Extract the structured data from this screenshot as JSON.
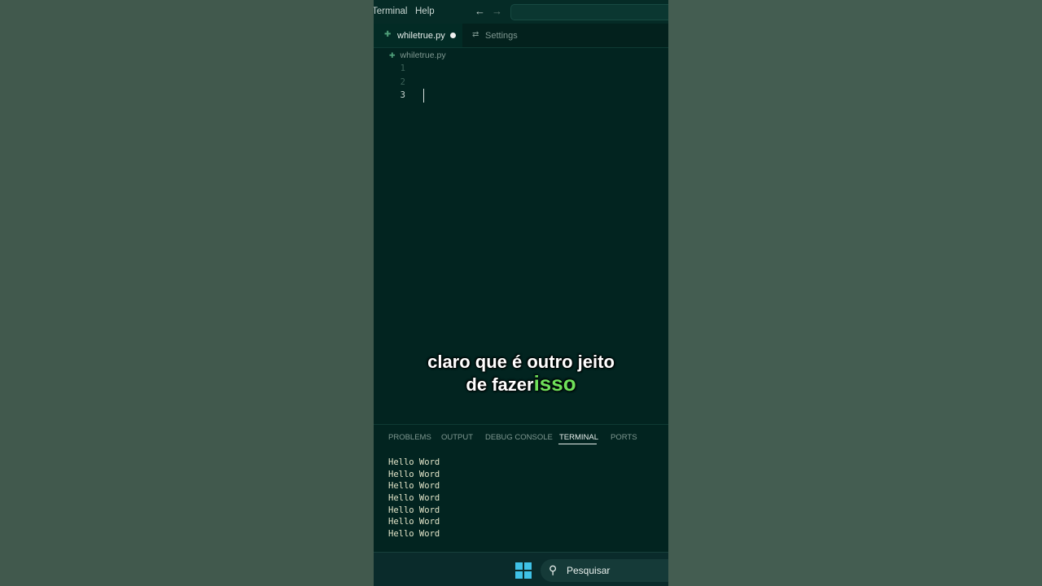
{
  "menubar": {
    "items": [
      "Terminal",
      "Help"
    ],
    "back_icon": "arrow-left-icon",
    "forward_icon": "arrow-right-icon"
  },
  "tabs": [
    {
      "label": "whiletrue.py",
      "icon": "python-file-icon",
      "modified": true,
      "active": true
    },
    {
      "label": "Settings",
      "icon": "settings-icon",
      "active": false
    }
  ],
  "breadcrumb": {
    "file": "whiletrue.py",
    "icon": "python-file-icon"
  },
  "editor": {
    "line_numbers": [
      "1",
      "2",
      "3"
    ],
    "current_line": "3"
  },
  "caption": {
    "line1": "claro que é outro jeito",
    "line2_a": "de fazer",
    "line2_b": "isso"
  },
  "panel": {
    "tabs": [
      "PROBLEMS",
      "OUTPUT",
      "DEBUG CONSOLE",
      "TERMINAL",
      "PORTS"
    ],
    "active_tab": "TERMINAL"
  },
  "terminal": {
    "lines": [
      "Hello Word",
      "Hello Word",
      "Hello Word",
      "Hello Word",
      "Hello Word",
      "Hello Word",
      "Hello Word"
    ]
  },
  "taskbar": {
    "search_label": "Pesquisar"
  },
  "colors": {
    "accent_green": "#6ee05a",
    "windows_blue": "#3fc1e6"
  }
}
